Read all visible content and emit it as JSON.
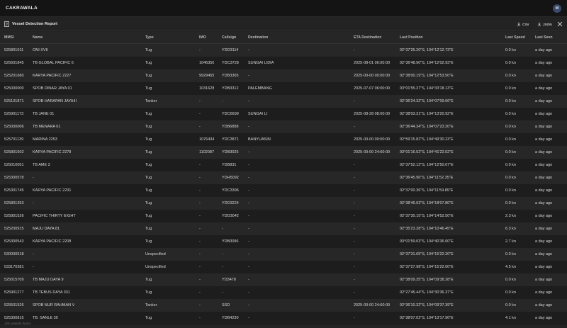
{
  "app": {
    "brand": "CAKRAWALA",
    "user_initial": "M"
  },
  "panel": {
    "title": "Vessel Detection Report",
    "csv_label": "CSV",
    "json_label": "JSON"
  },
  "columns": [
    "MMSI",
    "Name",
    "Type",
    "IMO",
    "Callsign",
    "Destination",
    "ETA Destination",
    "Last Position",
    "Last Speed",
    "Last Seen"
  ],
  "rows": [
    [
      "525801011",
      "ONI XVII",
      "Tug",
      "-",
      "YDD3114",
      "-",
      "-",
      "02°37'25.20\"S, 104°12'12.73\"E",
      "0.0 kn",
      "a day ago"
    ],
    [
      "525601845",
      "TB GLOBAL PACIFIC 6",
      "Tug",
      "1046350",
      "YDC3728",
      "SUNGAI LIDIA",
      "2025-08-01 06:00:00",
      "02°36'48.90\"S, 104°12'02.93\"E",
      "0.0 kn",
      "a day ago"
    ],
    [
      "525201680",
      "KARYA PACIFIC 2227",
      "Tug",
      "9929455",
      "YDB3305",
      "-",
      "2025-00-00 00:00:00",
      "02°38'00.19\"S, 104°12'53.50\"E",
      "0.0 kn",
      "a day ago"
    ],
    [
      "525000000",
      "SPOB DINAR JAYA 01",
      "Tug",
      "1031628",
      "YDB3312",
      "PALEMBANG",
      "2025-07-07 06:00:00",
      "03°01'55.37\"S, 104°33'18.13\"E",
      "0.0 kn",
      "a day ago"
    ],
    [
      "525101871",
      "SPOB HARAPAN JAYAIII",
      "Tanker",
      "-",
      "-",
      "-",
      "-",
      "02°36'24.32\"S, 104°07'09.06\"E",
      "0.0 kn",
      "a day ago"
    ],
    [
      "525901173",
      "TB JANE 01",
      "Tug",
      "-",
      "YDC6699",
      "SUNGAI LI",
      "2025-08-28 08:00:00",
      "02°38'03.31\"S, 104°13'20.92\"E",
      "0.0 kn",
      "a day ago"
    ],
    [
      "525000006",
      "TB MENARA 01",
      "Tug",
      "-",
      "YDB6898",
      "-",
      "-",
      "02°36'44.34\"S, 104°07'23.20\"E",
      "0.0 kn",
      "a day ago"
    ],
    [
      "525701139",
      "MARINA 2253",
      "Tug",
      "1076434",
      "YDC3871",
      "BANYUASIN",
      "2025-00-00 00:00:00",
      "02°59'15.82\"S, 104°49'30.23\"E",
      "0.0 kn",
      "a day ago"
    ],
    [
      "525801502",
      "KARYA PACIFIC 2278",
      "Tug",
      "1102087",
      "YDB3025",
      "-",
      "2025-00-00 24:60:00",
      "03°01'16.52\"S, 104°41'22.52\"E",
      "0.0 kn",
      "a day ago"
    ],
    [
      "525010051",
      "TB AME 2",
      "Tug",
      "-",
      "YDB831",
      "-",
      "-",
      "02°37'52.12\"S, 104°12'50.67\"E",
      "0.0 kn",
      "a day ago"
    ],
    [
      "525300578",
      "-",
      "Tug",
      "-",
      "YDH5092",
      "-",
      "-",
      "02°36'45.96\"S, 104°11'52.35\"E",
      "0.0 kn",
      "a day ago"
    ],
    [
      "525301745",
      "KARYA PACIFIC 2231",
      "Tug",
      "-",
      "YDC3396",
      "-",
      "-",
      "02°37'00.36\"S, 104°11'59.89\"E",
      "0.0 kn",
      "a day ago"
    ],
    [
      "525801353",
      "-",
      "Tug",
      "-",
      "YDD3224",
      "-",
      "-",
      "02°38'46.63\"S, 104°18'07.80\"E",
      "0.0 kn",
      "a day ago"
    ],
    [
      "525801526",
      "PACIFIC THIRTY EIGHT",
      "Tug",
      "-",
      "YDD3042",
      "-",
      "-",
      "02°37'30.15\"S, 104°14'52.50\"E",
      "2.3 kn",
      "a day ago"
    ],
    [
      "525200915",
      "MAJU DAYA 81",
      "Tug",
      "-",
      "-",
      "-",
      "-",
      "02°35'23.28\"S, 104°10'46.45\"E",
      "6.3 kn",
      "a day ago"
    ],
    [
      "525300543",
      "KARYA PACIFIC 2208",
      "Tug",
      "-",
      "YDB3096",
      "-",
      "-",
      "03°01'59.03\"S, 104°40'36.00\"E",
      "2.7 kn",
      "a day ago"
    ],
    [
      "530000518",
      "-",
      "Unspecified",
      "-",
      "-",
      "-",
      "-",
      "02°37'31.65\"S, 104°15'22.20\"E",
      "0.0 kn",
      "a day ago"
    ],
    [
      "533170381",
      "-",
      "Unspecified",
      "-",
      "-",
      "-",
      "-",
      "02°37'27.98\"S, 104°15'22.00\"E",
      "4.5 kn",
      "a day ago"
    ],
    [
      "525015709",
      "TB MAJU DAYA 9",
      "Tug",
      "-",
      "YD3478",
      "-",
      "-",
      "02°38'09.35\"S, 104°09'38.28\"E",
      "0.0 kn",
      "a day ago"
    ],
    [
      "525901277",
      "TB TEBUS DAYA 331",
      "Tug",
      "-",
      "-",
      "-",
      "-",
      "02°27'45.44\"S, 104°30'36.37\"E",
      "0.0 kn",
      "a day ago"
    ],
    [
      "525501526",
      "SPOB NUR RAHMAN V",
      "Tanker",
      "-",
      "SSD",
      "-",
      "2025-00-00 24:60:00",
      "02°36'10.32\"S, 104°09'37.39\"E",
      "0.0 kn",
      "a day ago"
    ],
    [
      "525300815",
      "TB. SANLE 30",
      "Tug",
      "-",
      "YDB4230",
      "-",
      "-",
      "02°38'07.02\"S, 104°13'17.90\"E",
      "4.1 kn",
      "a day ago"
    ]
  ],
  "footer": "126 vessels found"
}
